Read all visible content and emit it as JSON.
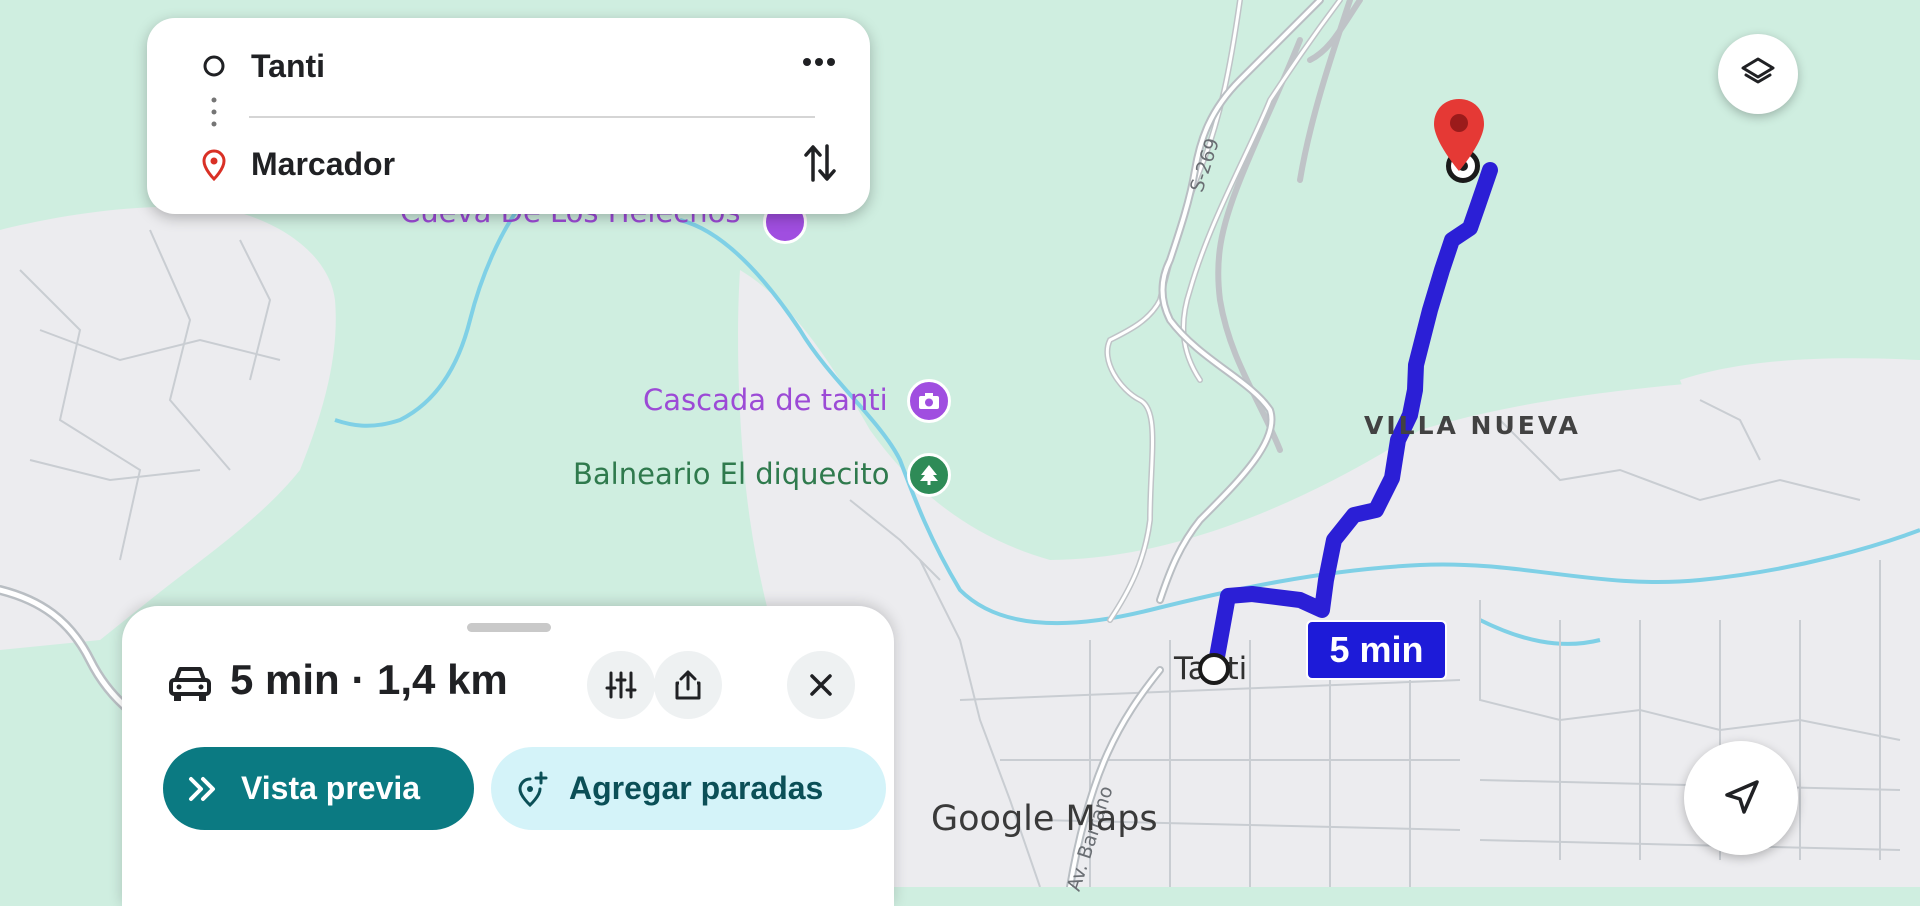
{
  "route": {
    "origin": "Tanti",
    "destination": "Marcador"
  },
  "map": {
    "poi_top_partial": "Cueva De Los Helechos",
    "poi_cascada": "Cascada de tanti",
    "poi_balneario": "Balneario El diquecito",
    "area_villa_nueva": "VILLA NUEVA",
    "town_tanti": "Tanti",
    "road_s269": "S-269",
    "road_av": "Av. Barrano",
    "watermark": "Google Maps",
    "eta_badge": "5 min",
    "route_color": "#2b1fd6",
    "destination_pin_color": "#e53935"
  },
  "sheet": {
    "summary": "5 min · 1,4 km",
    "preview_label": "Vista previa",
    "add_stops_label": "Agregar paradas",
    "mode_icon": "car-icon"
  },
  "colors": {
    "primary_button": "#0b7a82",
    "secondary_button": "#d4f3f9"
  }
}
